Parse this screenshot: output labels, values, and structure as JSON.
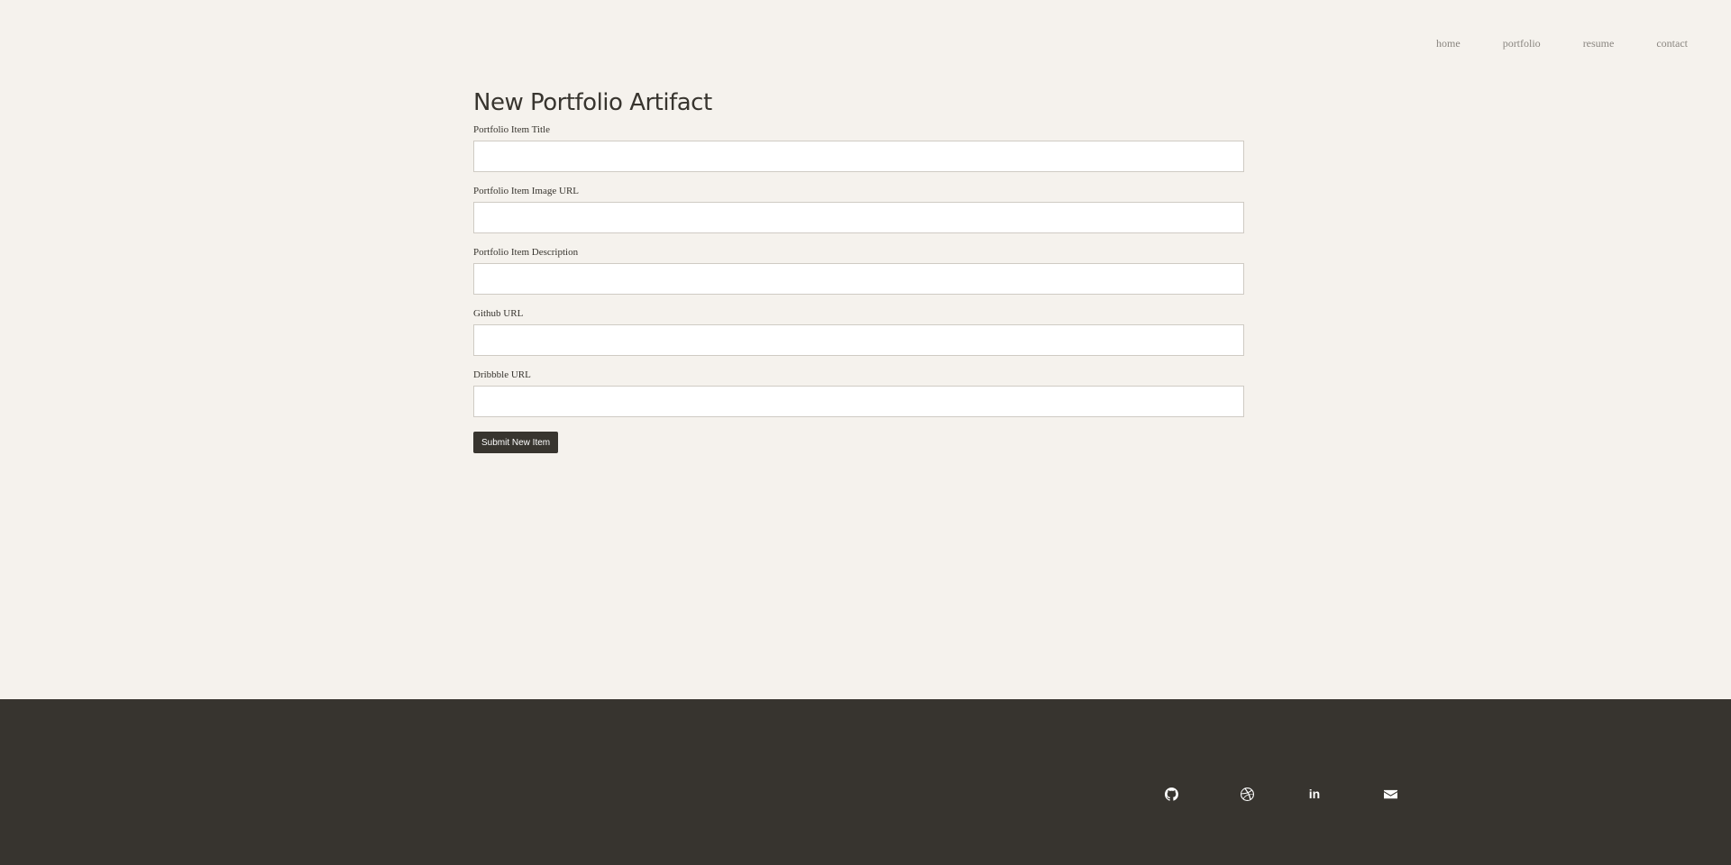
{
  "nav": {
    "items": [
      {
        "label": "home"
      },
      {
        "label": "portfolio"
      },
      {
        "label": "resume"
      },
      {
        "label": "contact"
      }
    ]
  },
  "form": {
    "title": "New Portfolio Artifact",
    "fields": [
      {
        "label": "Portfolio Item Title",
        "value": "",
        "placeholder": ""
      },
      {
        "label": "Portfolio Item Image URL",
        "value": "",
        "placeholder": ""
      },
      {
        "label": "Portfolio Item Description",
        "value": "",
        "placeholder": ""
      },
      {
        "label": "Github URL",
        "value": "",
        "placeholder": ""
      },
      {
        "label": "Dribbble URL",
        "value": "",
        "placeholder": ""
      }
    ],
    "submit_label": "Submit New Item"
  },
  "footer": {
    "icons": [
      "github-icon",
      "dribbble-icon",
      "linkedin-icon",
      "mail-icon"
    ],
    "linkedin_glyph": "in"
  },
  "colors": {
    "background": "#f5f2ed",
    "footer": "#37342f",
    "text": "#38352f",
    "button": "#38352f"
  }
}
